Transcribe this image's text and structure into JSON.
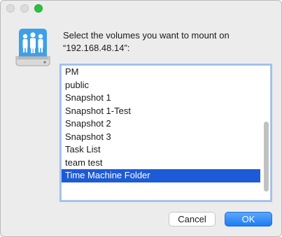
{
  "dialog": {
    "prompt_line1": "Select the volumes you want to mount on",
    "prompt_line2": "“192.168.48.14”:",
    "icon": "network-server-icon"
  },
  "volumes": [
    {
      "label": "PM",
      "selected": false
    },
    {
      "label": "public",
      "selected": false
    },
    {
      "label": "Snapshot 1",
      "selected": false
    },
    {
      "label": "Snapshot 1-Test",
      "selected": false
    },
    {
      "label": "Snapshot 2",
      "selected": false
    },
    {
      "label": "Snapshot 3",
      "selected": false
    },
    {
      "label": "Task List",
      "selected": false
    },
    {
      "label": "team test",
      "selected": false
    },
    {
      "label": "Time Machine Folder",
      "selected": true
    }
  ],
  "buttons": {
    "cancel_label": "Cancel",
    "ok_label": "OK"
  },
  "colors": {
    "selection": "#1d5bd6",
    "accent": "#1b7cf4",
    "zoom_button": "#2bc140"
  }
}
